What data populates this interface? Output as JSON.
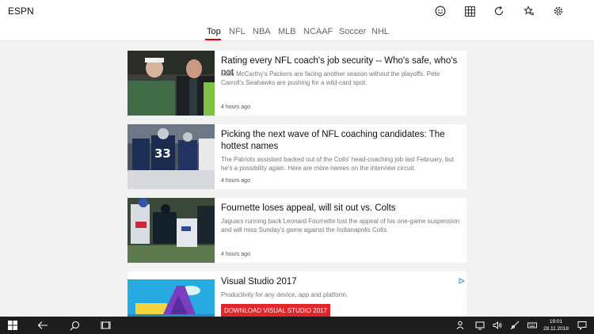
{
  "app": {
    "title": "ESPN"
  },
  "toolbar": {
    "icons": [
      "smiley-icon",
      "grid-icon",
      "refresh-icon",
      "favorites-icon",
      "gear-icon"
    ]
  },
  "tabs": [
    {
      "label": "Top",
      "active": true
    },
    {
      "label": "NFL"
    },
    {
      "label": "NBA"
    },
    {
      "label": "MLB"
    },
    {
      "label": "NCAAF"
    },
    {
      "label": "Soccer"
    },
    {
      "label": "NHL"
    }
  ],
  "articles": [
    {
      "title": "Rating every NFL coach's job security -- Who's safe, who's not",
      "description": "Mike McCarthy's Packers are facing another season without the playoffs. Pete Carroll's Seahawks are pushing for a wild-card spot.",
      "time": "4 hours ago"
    },
    {
      "title": "Picking the next wave of NFL coaching candidates: The hottest names",
      "description": "The Patriots assistant backed out of the Colts' head-coaching job last February, but he's a possibility again. Here are more names on the interview circuit.",
      "time": "4 hours ago"
    },
    {
      "title": "Fournette loses appeal, will sit out vs. Colts",
      "description": "Jaguars running back Leonard Fournette lost the appeal of his one-game suspension and will miss Sunday's game against the Indianapolis Colts.",
      "time": "4 hours ago"
    }
  ],
  "ad": {
    "title": "Visual Studio 2017",
    "description": "Productivity for any device, app and platform.",
    "button": "DOWNLOAD VISUAL STUDIO 2017"
  },
  "taskbar": {
    "clock_time": "19:01",
    "clock_date": "28.11.2018"
  },
  "colors": {
    "accent_red": "#dd0000",
    "ad_button": "#e3262a",
    "taskbar": "#1d1d1d"
  }
}
